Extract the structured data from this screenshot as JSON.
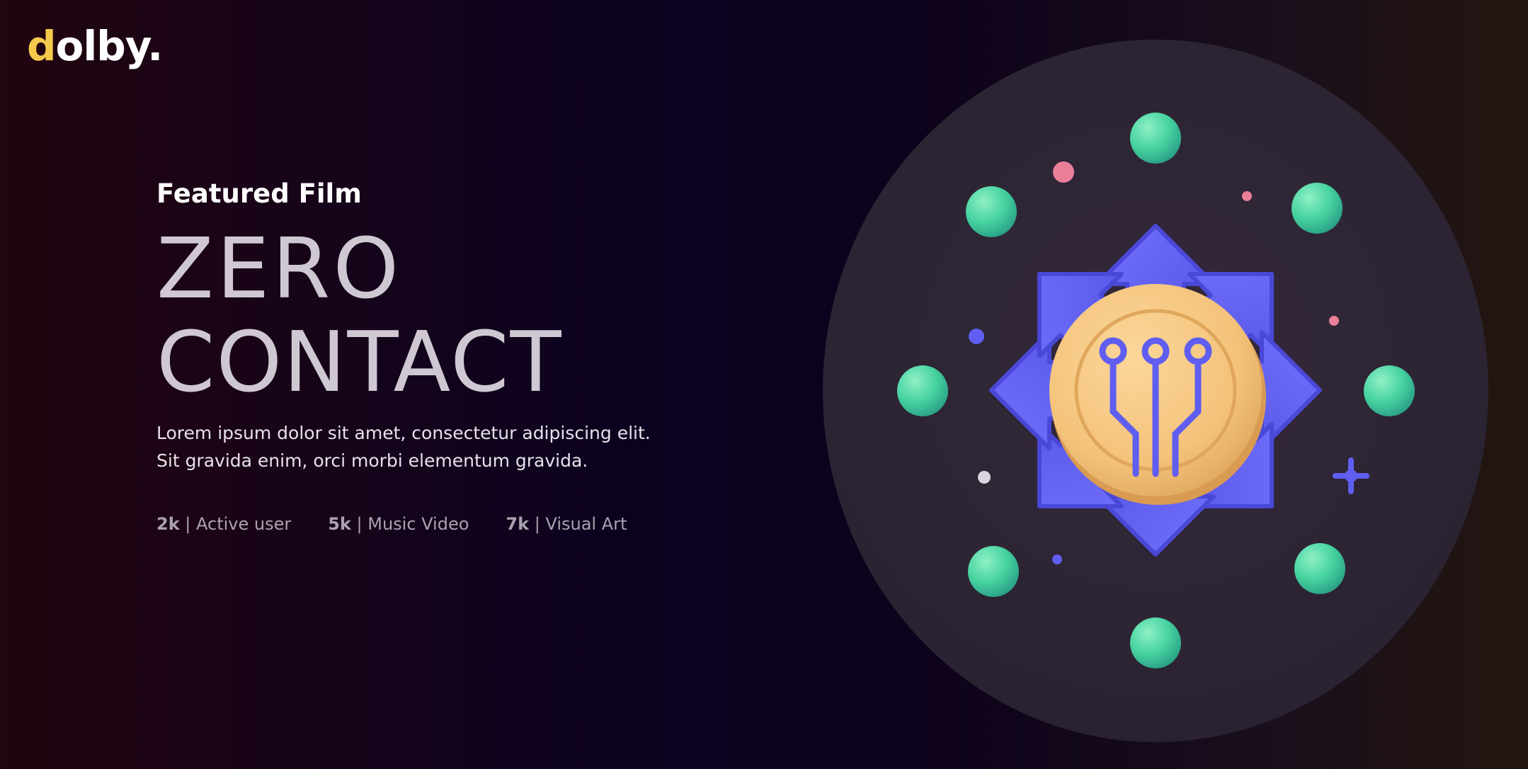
{
  "brand": {
    "logo_first": "d",
    "logo_rest": "olby.",
    "accent_color": "#f5c94b"
  },
  "hero": {
    "label": "Featured Film",
    "title_line_1": "ZERO",
    "title_line_2": "CONTACT",
    "description_line_1": "Lorem ipsum dolor sit amet, consectetur adipiscing elit.",
    "description_line_2": "Sit gravida enim, orci morbi elementum gravida."
  },
  "stats": [
    {
      "value": "2k",
      "separator": " | ",
      "label": "Active user"
    },
    {
      "value": "5k",
      "separator": " | ",
      "label": "Music Video"
    },
    {
      "value": "7k",
      "separator": " | ",
      "label": "Visual Art"
    }
  ],
  "illustration": {
    "icon": "network-hub-icon",
    "colors": {
      "arrow": "#5f5ef0",
      "coin": "#f4c27a",
      "node": "#47d3a0",
      "dot_pink": "#ea7f9a"
    }
  }
}
